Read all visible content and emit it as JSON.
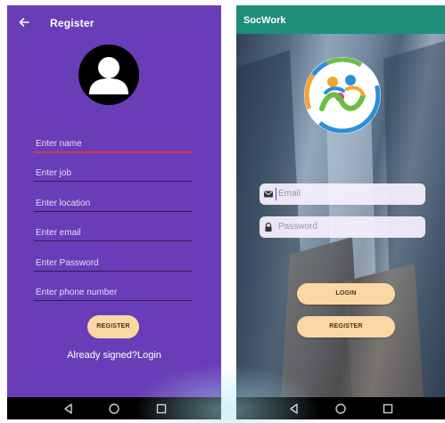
{
  "register_screen": {
    "title": "Register",
    "back_icon": "arrow-left-icon",
    "avatar_icon": "person-icon",
    "fields": [
      {
        "placeholder": "Enter name",
        "active": true
      },
      {
        "placeholder": "Enter job",
        "active": false
      },
      {
        "placeholder": "Enter location",
        "active": false
      },
      {
        "placeholder": "Enter email",
        "active": false
      },
      {
        "placeholder": "Enter Password",
        "active": false
      },
      {
        "placeholder": "Enter phone number",
        "active": false
      }
    ],
    "register_button": "REGISTER",
    "login_link": "Already signed?Login",
    "colors": {
      "background": "#6a3db8",
      "button": "#fbd7a6",
      "active_underline": "#d0384e"
    }
  },
  "login_screen": {
    "app_title": "SocWork",
    "logo_icon": "socwork-logo-icon",
    "email": {
      "placeholder": "Email",
      "icon": "envelope-icon"
    },
    "password": {
      "placeholder": "Password",
      "icon": "lock-icon"
    },
    "login_button": "LOGIN",
    "register_button": "REGISTER",
    "colors": {
      "appbar": "#1f8f79",
      "button": "#fbd7a6"
    }
  },
  "nav_bar": {
    "icons": [
      "back-triangle-icon",
      "home-circle-icon",
      "recents-square-icon"
    ]
  }
}
